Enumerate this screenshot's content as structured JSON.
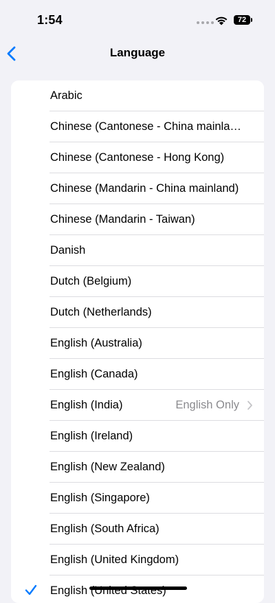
{
  "status_bar": {
    "time": "1:54",
    "battery": "72"
  },
  "nav": {
    "title": "Language"
  },
  "colors": {
    "accent": "#007aff",
    "background": "#f2f2f7",
    "secondary_text": "#8a8a8e"
  },
  "languages": [
    {
      "label": "Arabic"
    },
    {
      "label": "Chinese (Cantonese - China mainla…"
    },
    {
      "label": "Chinese (Cantonese - Hong Kong)"
    },
    {
      "label": "Chinese (Mandarin - China mainland)"
    },
    {
      "label": "Chinese (Mandarin - Taiwan)"
    },
    {
      "label": "Danish"
    },
    {
      "label": "Dutch (Belgium)"
    },
    {
      "label": "Dutch (Netherlands)"
    },
    {
      "label": "English (Australia)"
    },
    {
      "label": "English (Canada)"
    },
    {
      "label": "English (India)",
      "detail": "English Only"
    },
    {
      "label": "English (Ireland)"
    },
    {
      "label": "English (New Zealand)"
    },
    {
      "label": "English (Singapore)"
    },
    {
      "label": "English (South Africa)"
    },
    {
      "label": "English (United Kingdom)"
    },
    {
      "label": "English (United States)",
      "selected": true
    }
  ]
}
